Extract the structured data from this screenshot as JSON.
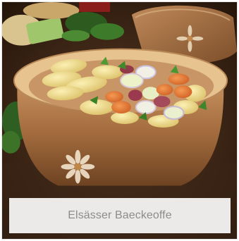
{
  "card": {
    "caption": "Elsässer Baeckeoffe",
    "image_alt": "Elsässer Baeckeoffe"
  },
  "colors": {
    "background": "#3a2618",
    "dish": "#b07a4c",
    "dish_rim": "#e8c48f",
    "potato": "#f1de86",
    "carrot": "#e2762f",
    "leek": "#e9eed0",
    "herb": "#3f7d2c",
    "caption_bg": "#f6f6f6",
    "caption_text": "#8c8c8c"
  },
  "icons": [
    "decorative-flower-icon"
  ]
}
